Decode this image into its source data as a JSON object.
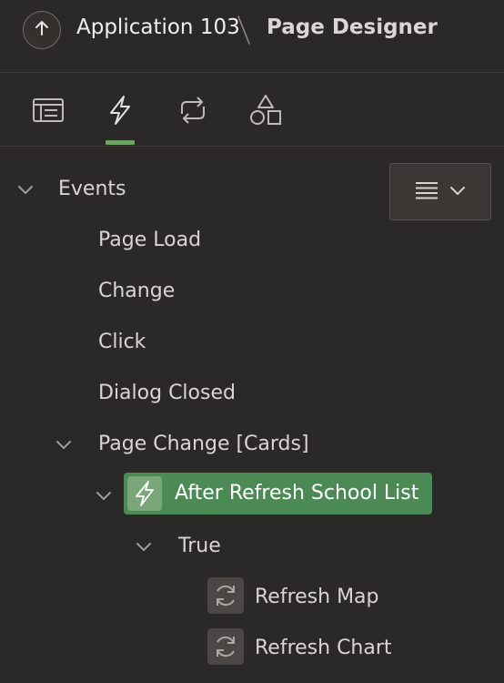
{
  "header": {
    "app_title": "Application 103",
    "separator": "\\",
    "page_title": "Page Designer"
  },
  "tabs": [
    {
      "name": "rendering",
      "icon": "layout-icon",
      "active": false
    },
    {
      "name": "dynamic-actions",
      "icon": "lightning-icon",
      "active": true
    },
    {
      "name": "processing",
      "icon": "refresh-icon",
      "active": false
    },
    {
      "name": "shared-components",
      "icon": "shapes-icon",
      "active": false
    }
  ],
  "tree": {
    "events_label": "Events",
    "items": [
      {
        "label": "Page Load"
      },
      {
        "label": "Change"
      },
      {
        "label": "Click"
      },
      {
        "label": "Dialog Closed"
      },
      {
        "label": "Page Change [Cards]"
      }
    ],
    "selected_action": "After Refresh School List",
    "true_label": "True",
    "actions": [
      {
        "label": "Refresh Map",
        "icon": "refresh-icon"
      },
      {
        "label": "Refresh Chart",
        "icon": "refresh-icon"
      }
    ]
  },
  "colors": {
    "background": "#2b2927",
    "accent": "#4c8a55",
    "tab_indicator": "#6fa466"
  }
}
